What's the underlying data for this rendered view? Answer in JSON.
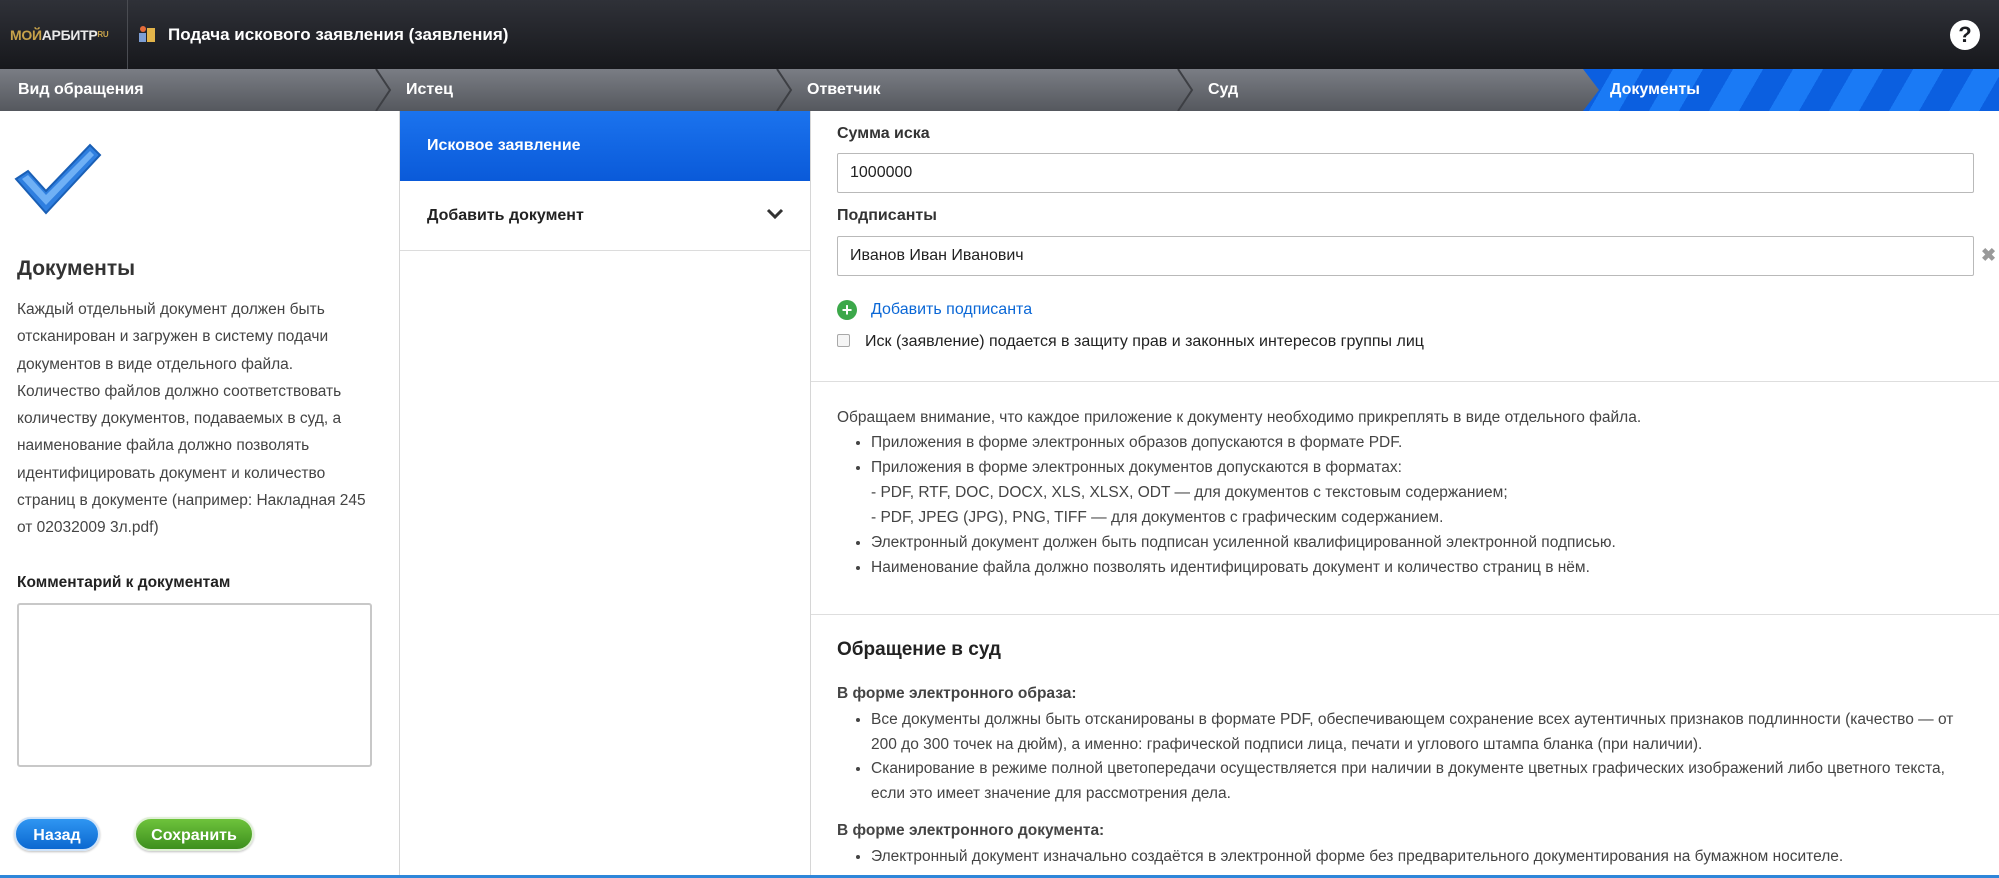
{
  "app": {
    "logo_moy": "МОЙ",
    "logo_arb": "АРБИТР",
    "logo_sup": "RU",
    "title": "Подача искового заявления (заявления)",
    "help": "?"
  },
  "steps": [
    {
      "label": "Вид обращения"
    },
    {
      "label": "Истец"
    },
    {
      "label": "Ответчик"
    },
    {
      "label": "Суд"
    },
    {
      "label": "Документы",
      "active": true
    }
  ],
  "left": {
    "title": "Документы",
    "description": "Каждый отдельный документ должен быть отсканирован и загружен в систему подачи документов в виде отдельного файла. Количество файлов должно соответствовать количеству документов, подаваемых в суд, а наименование файла должно позволять идентифицировать документ и количество страниц в документе (например: Накладная 245 от 02032009 3л.pdf)",
    "comment_label": "Комментарий к документам",
    "comment_value": "",
    "back_button": "Назад",
    "save_button": "Сохранить"
  },
  "middle": {
    "active_item": "Исковое заявление",
    "add_document": "Добавить документ"
  },
  "form": {
    "sum_label": "Сумма иска",
    "sum_value": "1000000",
    "signers_label": "Подписанты",
    "signer_value": "Иванов Иван Иванович",
    "add_signer": "Добавить подписанта",
    "group_checkbox_label": "Иск (заявление) подается в защиту прав и законных интересов группы лиц",
    "group_checkbox_checked": false
  },
  "note": {
    "intro": "Обращаем внимание, что каждое приложение к документу необходимо прикреплять в виде отдельного файла.",
    "bullets": [
      "Приложения в форме электронных образов допускаются в формате PDF.",
      "Приложения в форме электронных документов допускаются в форматах:",
      "Электронный документ должен быть подписан усиленной квалифицированной электронной подписью.",
      "Наименование файла должно позволять идентифицировать документ и количество страниц в нём."
    ],
    "formats_text": "- PDF, RTF, DOC, DOCX, XLS, XLSX, ODT — для документов с текстовым содержанием;",
    "formats_graphic": "- PDF, JPEG (JPG), PNG, TIFF — для документов с графическим содержанием."
  },
  "appeal": {
    "title": "Обращение в суд",
    "image_form_title": "В форме электронного образа:",
    "image_form_bullets": [
      "Все документы должны быть отсканированы в формате PDF, обеспечивающем сохранение всех аутентичных признаков подлинности (качество — от 200 до 300 точек на дюйм), а именно: графической подписи лица, печати и углового штампа бланка (при наличии).",
      "Сканирование в режиме полной цветопередачи осуществляется при наличии в документе цветных графических изображений либо цветного текста, если это имеет значение для рассмотрения дела."
    ],
    "doc_form_title": "В форме электронного документа:",
    "doc_form_bullets": [
      "Электронный документ изначально создаётся в электронной форме без предварительного документирования на бумажном носителе."
    ]
  },
  "colors": {
    "topbar": "#1f2126",
    "accent_blue": "#0b5fe0",
    "save_green": "#4ea42a",
    "link_blue": "#0a67d6"
  }
}
